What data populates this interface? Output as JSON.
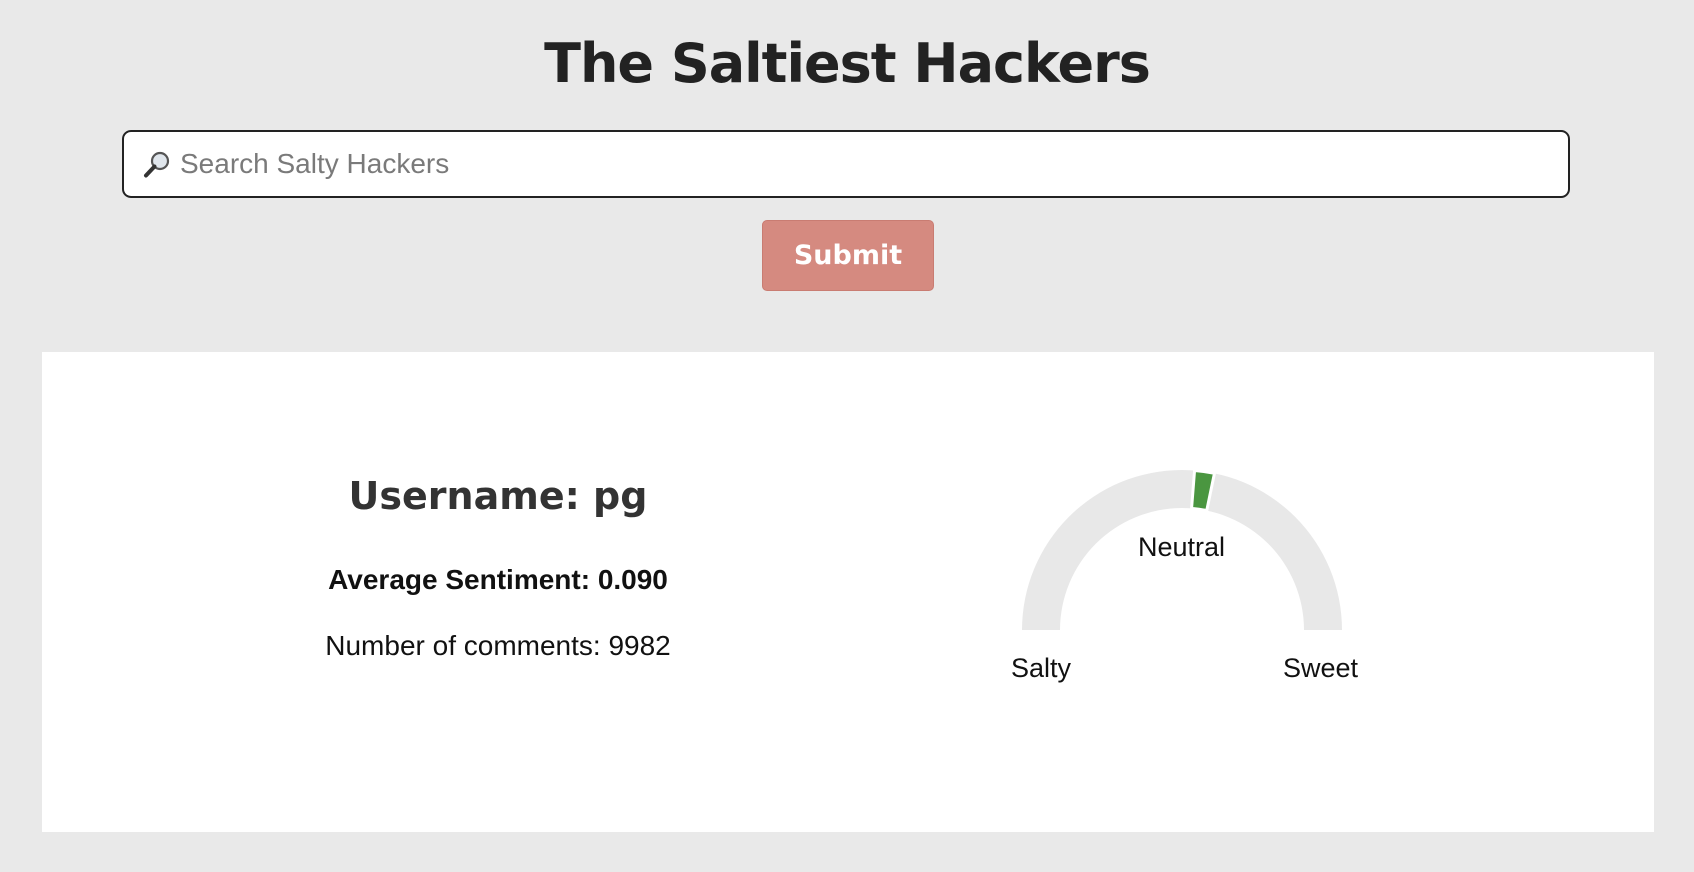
{
  "header": {
    "title": "The Saltiest Hackers"
  },
  "search": {
    "placeholder": "Search Salty Hackers",
    "value": "",
    "icon": "magnifying-glass-icon"
  },
  "actions": {
    "submit_label": "Submit"
  },
  "result": {
    "username_label": "Username: pg",
    "average_sentiment_label": "Average Sentiment: 0.090",
    "average_sentiment_value": 0.09,
    "comment_count_label": "Number of comments: 9982",
    "comment_count_value": 9982
  },
  "gauge": {
    "min": -1,
    "max": 1,
    "value": 0.09,
    "center_label": "Neutral",
    "left_label": "Salty",
    "right_label": "Sweet",
    "colors": {
      "track": "#e8e8e8",
      "indicator": "#4a9640"
    }
  },
  "colors": {
    "background": "#e9e9e9",
    "submit": "#d58a80",
    "card": "#ffffff",
    "text": "#222222"
  }
}
